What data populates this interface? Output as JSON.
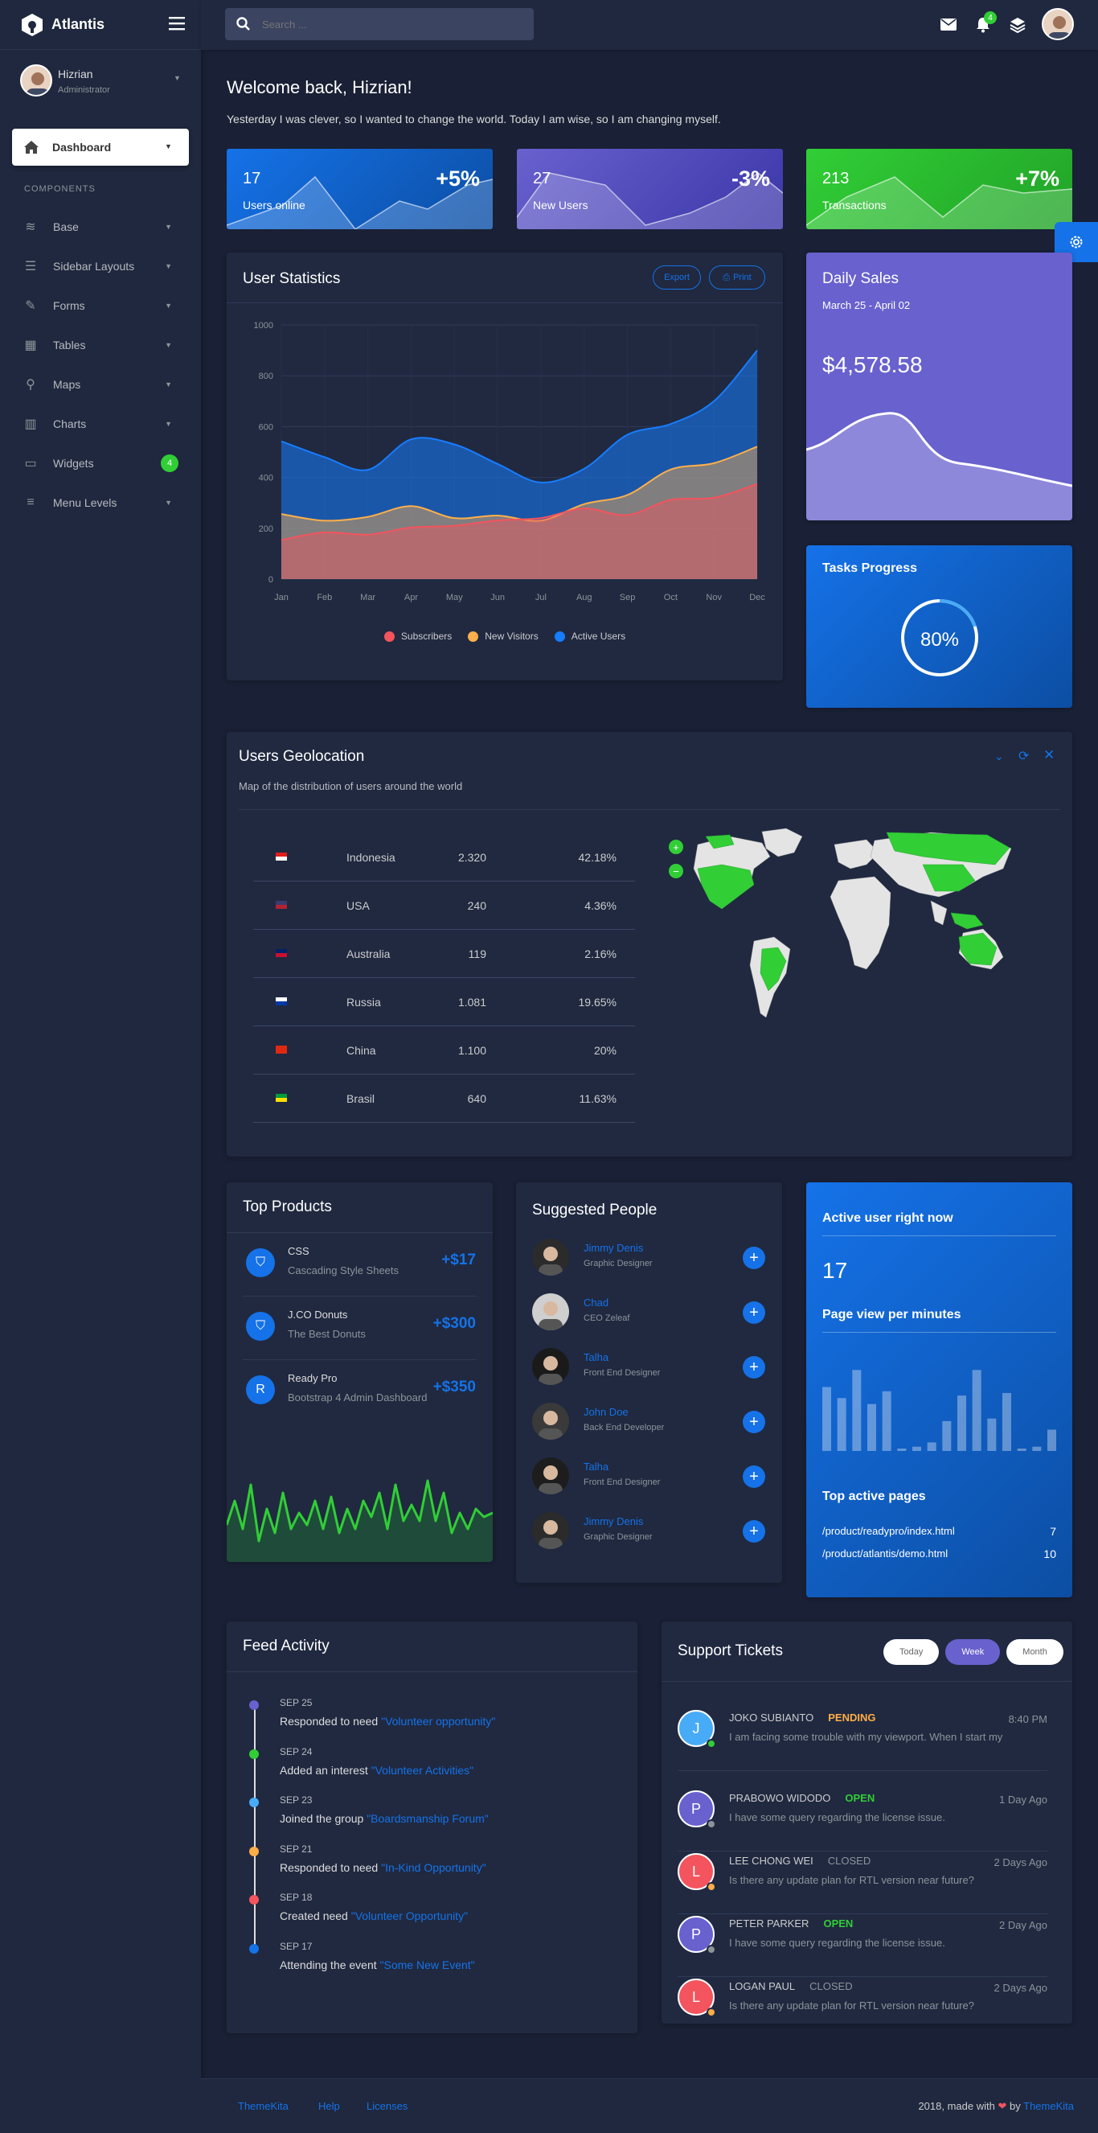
{
  "brand": {
    "name": "Atlantis"
  },
  "topbar": {
    "search_placeholder": "Search ...",
    "notification_count": "4"
  },
  "user": {
    "name": "Hizrian",
    "role": "Administrator"
  },
  "sidebar": {
    "dashboard_label": "Dashboard",
    "section_label": "COMPONENTS",
    "items": [
      {
        "label": "Base",
        "icon": "layers-icon"
      },
      {
        "label": "Sidebar Layouts",
        "icon": "th-list-icon"
      },
      {
        "label": "Forms",
        "icon": "pen-square-icon"
      },
      {
        "label": "Tables",
        "icon": "table-icon"
      },
      {
        "label": "Maps",
        "icon": "map-marker-icon"
      },
      {
        "label": "Charts",
        "icon": "chart-bar-icon"
      },
      {
        "label": "Widgets",
        "icon": "desktop-icon",
        "badge": "4"
      },
      {
        "label": "Menu Levels",
        "icon": "bars-icon"
      }
    ]
  },
  "welcome": {
    "title": "Welcome back, Hizrian!",
    "subtitle": "Yesterday I was clever, so I wanted to change the world. Today I am wise, so I am changing myself."
  },
  "stats": [
    {
      "value": "17",
      "label": "Users online",
      "change": "+5%",
      "color": "#1572e8"
    },
    {
      "value": "27",
      "label": "New Users",
      "change": "-3%",
      "color": "#6861ce"
    },
    {
      "value": "213",
      "label": "Transactions",
      "change": "+7%",
      "color": "#31ce36"
    }
  ],
  "user_statistics": {
    "title": "User Statistics",
    "export_label": "Export",
    "print_label": "Print"
  },
  "chart_data": {
    "type": "area",
    "categories": [
      "Jan",
      "Feb",
      "Mar",
      "Apr",
      "May",
      "Jun",
      "Jul",
      "Aug",
      "Sep",
      "Oct",
      "Nov",
      "Dec"
    ],
    "yticks": [
      "0",
      "200",
      "400",
      "600",
      "800",
      "1000"
    ],
    "ylim": [
      0,
      1000
    ],
    "series": [
      {
        "name": "Subscribers",
        "color": "#f3545d",
        "values": [
          154,
          184,
          175,
          203,
          210,
          231,
          240,
          278,
          252,
          312,
          320,
          374
        ]
      },
      {
        "name": "New Visitors",
        "color": "#fdaf4b",
        "values": [
          256,
          230,
          245,
          287,
          240,
          250,
          230,
          295,
          331,
          431,
          456,
          521
        ]
      },
      {
        "name": "Active Users",
        "color": "#177dff",
        "values": [
          542,
          480,
          430,
          550,
          530,
          453,
          380,
          434,
          568,
          610,
          700,
          900
        ]
      }
    ]
  },
  "daily_sales": {
    "title": "Daily Sales",
    "range": "March 25 - April 02",
    "amount": "$4,578.58"
  },
  "tasks": {
    "title": "Tasks Progress",
    "value": "80%",
    "fraction": 0.8
  },
  "geo": {
    "title": "Users Geolocation",
    "subtitle": "Map of the distribution of users around the world",
    "rows": [
      {
        "country": "Indonesia",
        "users": "2.320",
        "pct": "42.18%"
      },
      {
        "country": "USA",
        "users": "240",
        "pct": "4.36%"
      },
      {
        "country": "Australia",
        "users": "119",
        "pct": "2.16%"
      },
      {
        "country": "Russia",
        "users": "1.081",
        "pct": "19.65%"
      },
      {
        "country": "China",
        "users": "1.100",
        "pct": "20%"
      },
      {
        "country": "Brasil",
        "users": "640",
        "pct": "11.63%"
      }
    ],
    "zoom_in": "+",
    "zoom_out": "−"
  },
  "top_products": {
    "title": "Top Products",
    "items": [
      {
        "name": "CSS",
        "desc": "Cascading Style Sheets",
        "price": "+$17",
        "icon": "css3-icon"
      },
      {
        "name": "J.CO Donuts",
        "desc": "The Best Donuts",
        "price": "+$300",
        "icon": "css3-icon"
      },
      {
        "name": "Ready Pro",
        "desc": "Bootstrap 4 Admin Dashboard",
        "price": "+$350",
        "icon": "letter-r-icon"
      }
    ]
  },
  "suggested": {
    "title": "Suggested People",
    "people": [
      {
        "name": "Jimmy Denis",
        "role": "Graphic Designer"
      },
      {
        "name": "Chad",
        "role": "CEO Zeleaf"
      },
      {
        "name": "Talha",
        "role": "Front End Designer"
      },
      {
        "name": "John Doe",
        "role": "Back End Developer"
      },
      {
        "name": "Talha",
        "role": "Front End Designer"
      },
      {
        "name": "Jimmy Denis",
        "role": "Graphic Designer"
      }
    ]
  },
  "active_users": {
    "title": "Active user right now",
    "count": "17",
    "pv_title": "Page view per minutes",
    "bars": [
      0.75,
      0.62,
      0.95,
      0.55,
      0.7,
      0.02,
      0.05,
      0.1,
      0.35,
      0.65,
      0.95,
      0.38,
      0.68,
      0.02,
      0.05,
      0.25
    ],
    "pages_title": "Top active pages",
    "pages": [
      {
        "path": "/product/readypro/index.html",
        "count": "7"
      },
      {
        "path": "/product/atlantis/demo.html",
        "count": "10"
      }
    ]
  },
  "feed": {
    "title": "Feed Activity",
    "items": [
      {
        "date": "SEP 25",
        "text": "Responded to need ",
        "link": "\"Volunteer opportunity\"",
        "color": "#6861ce"
      },
      {
        "date": "SEP 24",
        "text": "Added an interest ",
        "link": "\"Volunteer Activities\"",
        "color": "#31ce36"
      },
      {
        "date": "SEP 23",
        "text": "Joined the group ",
        "link": "\"Boardsmanship Forum\"",
        "color": "#48abf7"
      },
      {
        "date": "SEP 21",
        "text": "Responded to need ",
        "link": "\"In-Kind Opportunity\"",
        "color": "#ffad46"
      },
      {
        "date": "SEP 18",
        "text": "Created need ",
        "link": "\"Volunteer Opportunity\"",
        "color": "#f3545d"
      },
      {
        "date": "SEP 17",
        "text": "Attending the event ",
        "link": "\"Some New Event\"",
        "color": "#1572e8"
      }
    ]
  },
  "tickets": {
    "title": "Support Tickets",
    "tabs": [
      "Today",
      "Week",
      "Month"
    ],
    "active_tab": "Week",
    "items": [
      {
        "initial": "J",
        "name": "JOKO SUBIANTO",
        "status": "PENDING",
        "status_color": "#ffad46",
        "time": "8:40 PM",
        "body": "I am facing some trouble with my viewport. When I start my",
        "avatar_color": "#48abf7",
        "dot_color": "#31ce36"
      },
      {
        "initial": "P",
        "name": "PRABOWO WIDODO",
        "status": "OPEN",
        "status_color": "#31ce36",
        "time": "1 Day Ago",
        "body": "I have some query regarding the license issue.",
        "avatar_color": "#6861ce",
        "dot_color": "#8d9498"
      },
      {
        "initial": "L",
        "name": "LEE CHONG WEI",
        "status": "CLOSED",
        "status_color": "#8d9498",
        "time": "2 Days Ago",
        "body": "Is there any update plan for RTL version near future?",
        "avatar_color": "#f3545d",
        "dot_color": "#ffad46"
      },
      {
        "initial": "P",
        "name": "PETER PARKER",
        "status": "OPEN",
        "status_color": "#31ce36",
        "time": "2 Day Ago",
        "body": "I have some query regarding the license issue.",
        "avatar_color": "#6861ce",
        "dot_color": "#8d9498"
      },
      {
        "initial": "L",
        "name": "LOGAN PAUL",
        "status": "CLOSED",
        "status_color": "#8d9498",
        "time": "2 Days Ago",
        "body": "Is there any update plan for RTL version near future?",
        "avatar_color": "#f3545d",
        "dot_color": "#ffad46"
      }
    ]
  },
  "footer": {
    "links": [
      "ThemeKita",
      "Help",
      "Licenses"
    ],
    "made_with": "2018, made with",
    "by": "by",
    "brand": "ThemeKita"
  }
}
